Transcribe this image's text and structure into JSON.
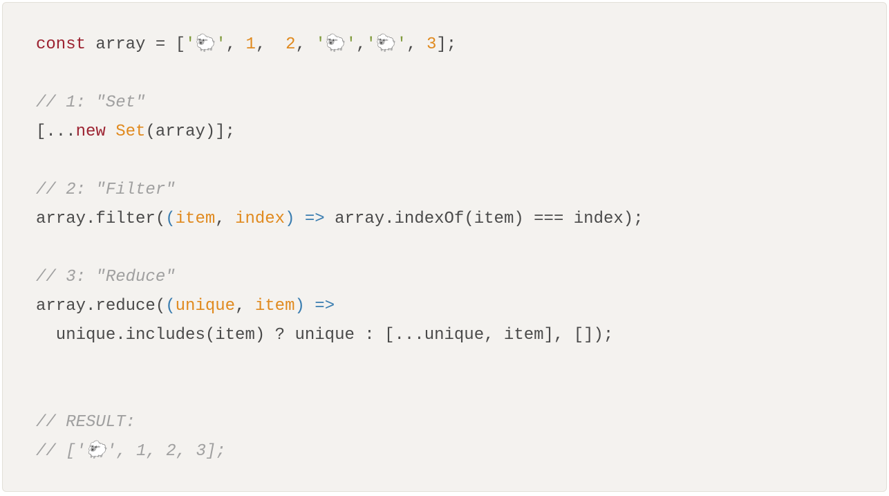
{
  "code": {
    "l1": {
      "const": "const",
      "arrayEq": " array = [",
      "s1": "'🐑'",
      "c1": ", ",
      "n1": "1",
      "c2": ",  ",
      "n2": "2",
      "c3": ", ",
      "s2": "'🐑'",
      "c4": ",",
      "s3": "'🐑'",
      "c5": ", ",
      "n3": "3",
      "end": "];"
    },
    "blank1": "",
    "l2": "// 1: \"Set\"",
    "l3": {
      "a": "[...",
      "new": "new",
      "sp": " ",
      "set": "Set",
      "b": "(array)];"
    },
    "blank2": "",
    "l4": "// 2: \"Filter\"",
    "l5": {
      "a": "array.filter(",
      "p1": "(",
      "arg1": "item",
      "comma": ", ",
      "arg2": "index",
      "p2": ")",
      "arrow": " =>",
      "b": " array.indexOf(item) === index);"
    },
    "blank3": "",
    "l6": "// 3: \"Reduce\"",
    "l7": {
      "a": "array.reduce(",
      "p1": "(",
      "arg1": "unique",
      "comma": ", ",
      "arg2": "item",
      "p2": ")",
      "arrow": " =>"
    },
    "l8": "  unique.includes(item) ? unique : [...unique, item], []);",
    "blank4": "",
    "blank5": "",
    "l9": "// RESULT:",
    "l10": "// ['🐑', 1, 2, 3];"
  }
}
